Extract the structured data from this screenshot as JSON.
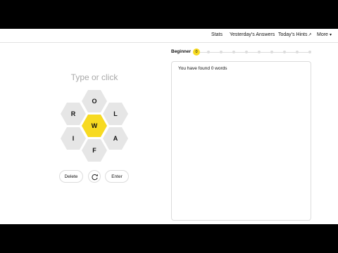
{
  "nav": {
    "stats": "Stats",
    "yesterdays_answers": "Yesterday’s Answers",
    "todays_hints": "Today’s Hints",
    "todays_hints_arrow": "↗",
    "more": "More",
    "more_caret": "▾"
  },
  "input": {
    "placeholder": "Type or click"
  },
  "hive": {
    "center": "W",
    "top": "O",
    "upper_left": "R",
    "upper_right": "L",
    "lower_left": "I",
    "lower_right": "A",
    "bottom": "F"
  },
  "controls": {
    "delete": "Delete",
    "enter": "Enter",
    "shuffle_icon": "shuffle-icon"
  },
  "rank": {
    "label": "Beginner",
    "score": "0"
  },
  "words": {
    "found_text": "You have found 0 words"
  },
  "colors": {
    "accent": "#f7da21",
    "tile": "#e6e6e6",
    "border": "#dcdcdc"
  }
}
